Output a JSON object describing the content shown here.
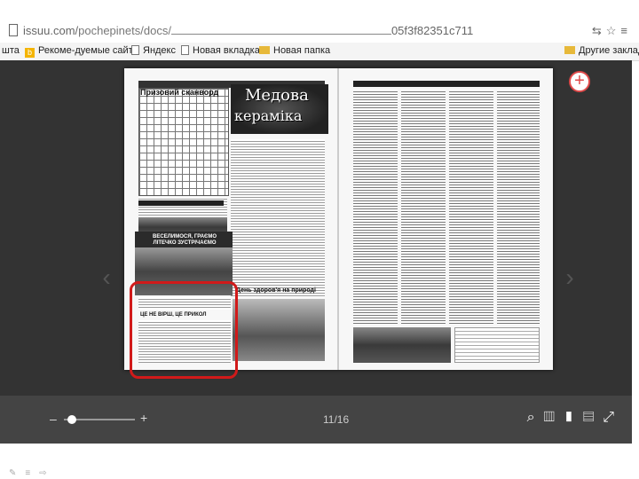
{
  "address_bar": {
    "url_prefix": "issuu.com/",
    "url_path": "pochepinets/docs/",
    "url_suffix": "05f3f82351c711"
  },
  "bookmarks": {
    "truncated_first": "шта",
    "items": [
      {
        "label": "Рекоме-дуемые сайты",
        "icon": "yandex-b-icon"
      },
      {
        "label": "Яндекс",
        "icon": "page-icon"
      },
      {
        "label": "Новая вкладка",
        "icon": "page-icon"
      },
      {
        "label": "Новая папка",
        "icon": "folder-icon"
      }
    ],
    "other": "Другие заклад"
  },
  "page_left": {
    "header_title": "Призовий сканворд",
    "art_title_line1": "Медова",
    "art_title_line2": "кераміка",
    "photo_banner_line1": "ВЕСЕЛИМОСЯ, ГРАЄМО",
    "photo_banner_line2": "ЛІТЕЧКО ЗУСТРІЧАЄМО",
    "section_title": "День здоров'я на природі",
    "bottom_heading": "ЦЕ НЕ ВІРШ, ЦЕ ПРИКОЛ"
  },
  "viewer": {
    "page_indicator": "11/16",
    "zoom_minus": "–",
    "zoom_plus": "+",
    "zoom_level": 0.05
  },
  "colors": {
    "viewer_bg": "#333333",
    "controls_bg": "#444444",
    "highlight": "#d11a1a"
  }
}
